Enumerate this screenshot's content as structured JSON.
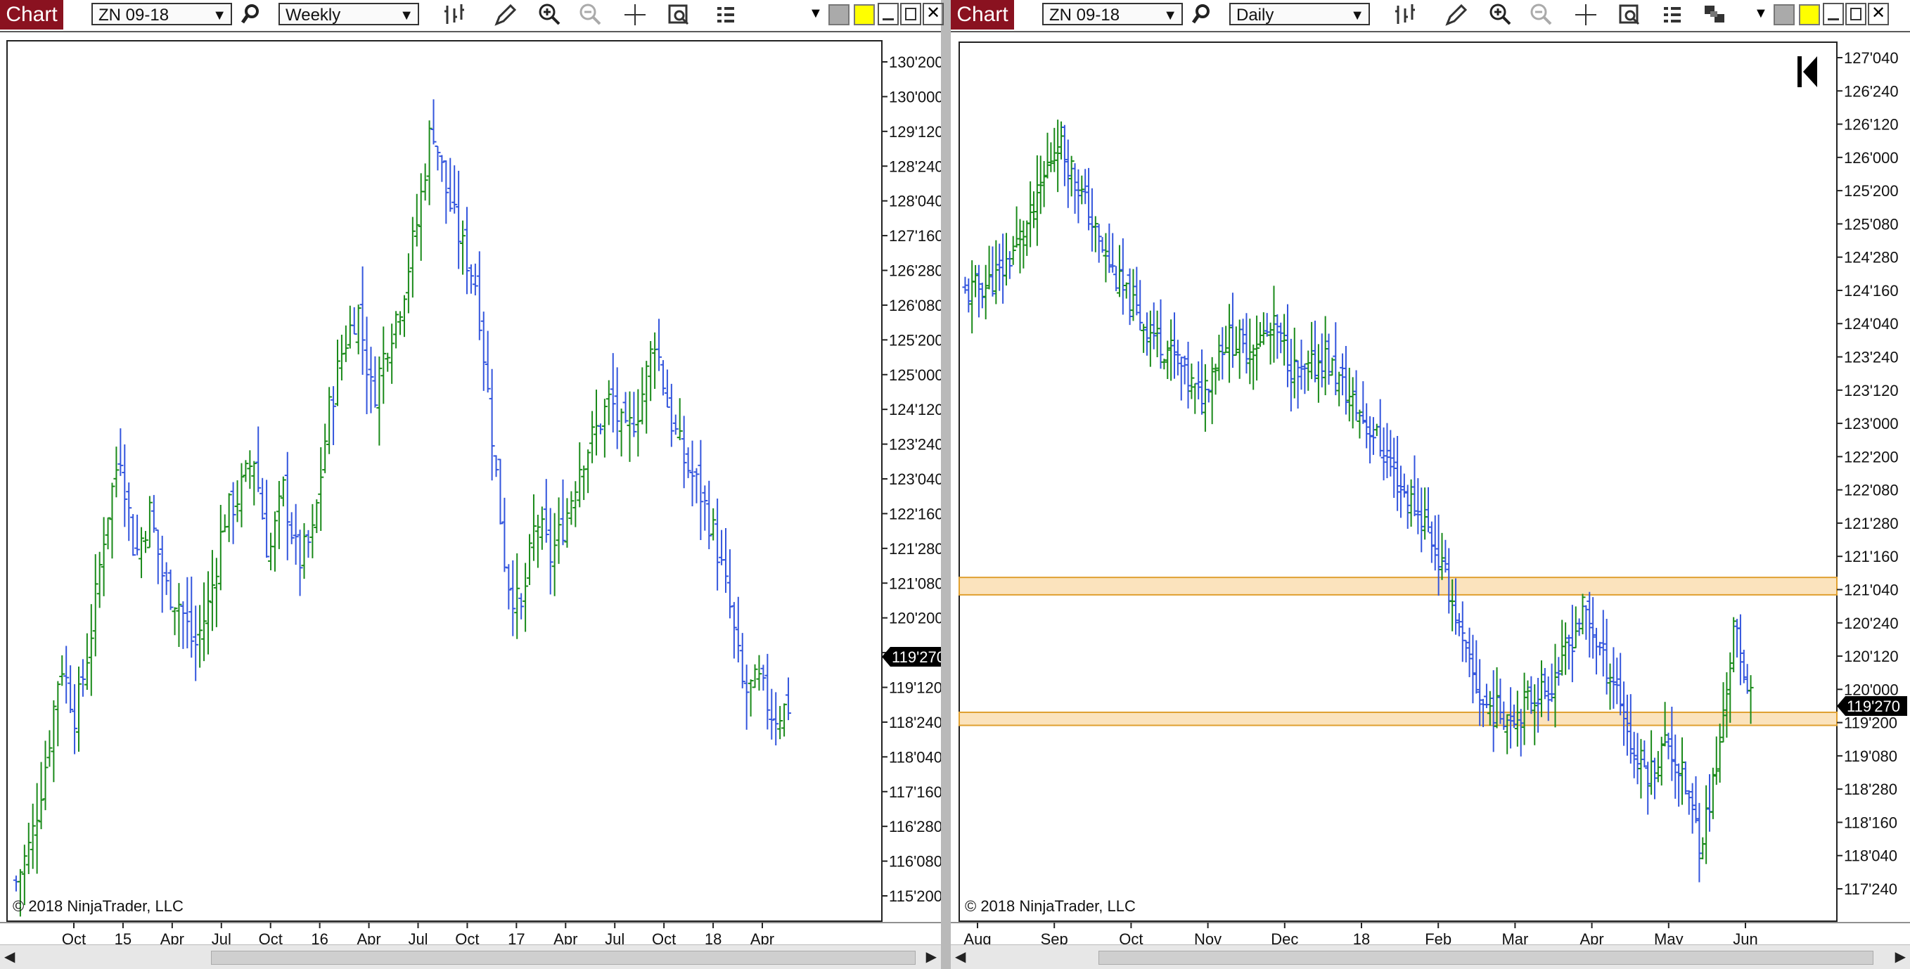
{
  "colors": {
    "up_bar": "#1a8a1a",
    "down_bar": "#3355dd",
    "zone_fill": "#fbe3bd",
    "zone_border": "#e0a030",
    "tab_bg": "#8a1220"
  },
  "left": {
    "tab_label": "Chart",
    "instrument": "ZN 09-18",
    "timeframe": "Weekly",
    "price_tag": "119'270",
    "copyright": "© 2018 NinjaTrader, LLC",
    "toolbar_icons": [
      "search-icon",
      "bar-style-icon",
      "pencil-icon",
      "zoom-in-icon",
      "zoom-out-icon",
      "crosshair-icon",
      "properties-icon",
      "indicators-icon",
      "dropdown-arrow-icon",
      "minimize-icon",
      "restore-icon",
      "close-icon"
    ],
    "y_labels": [
      "130'200",
      "130'000",
      "129'120",
      "128'240",
      "128'040",
      "127'160",
      "126'280",
      "126'080",
      "125'200",
      "125'000",
      "124'120",
      "123'240",
      "123'040",
      "122'160",
      "121'280",
      "121'080",
      "120'200",
      "120'000",
      "119'120",
      "118'240",
      "118'040",
      "117'160",
      "116'280",
      "116'080",
      "115'200"
    ],
    "x_labels": [
      "Oct",
      "15",
      "Apr",
      "Jul",
      "Oct",
      "16",
      "Apr",
      "Jul",
      "Oct",
      "17",
      "Apr",
      "Jul",
      "Oct",
      "18",
      "Apr"
    ]
  },
  "right": {
    "tab_label": "Chart",
    "instrument": "ZN 09-18",
    "timeframe": "Daily",
    "price_tag": "119'270",
    "copyright": "© 2018 NinjaTrader, LLC",
    "toolbar_icons": [
      "search-icon",
      "bar-style-icon",
      "pencil-icon",
      "zoom-in-icon",
      "zoom-out-icon",
      "crosshair-icon",
      "properties-icon",
      "indicators-icon",
      "strategies-icon",
      "dropdown-arrow-icon",
      "minimize-icon",
      "restore-icon",
      "close-icon"
    ],
    "y_labels": [
      "127'040",
      "126'240",
      "126'120",
      "126'000",
      "125'200",
      "125'080",
      "124'280",
      "124'160",
      "124'040",
      "123'240",
      "123'120",
      "123'000",
      "122'200",
      "122'080",
      "121'280",
      "121'160",
      "121'040",
      "120'240",
      "120'120",
      "120'000",
      "119'200",
      "119'080",
      "118'280",
      "118'160",
      "118'040",
      "117'240"
    ],
    "x_labels": [
      "Aug",
      "Sep",
      "Oct",
      "Nov",
      "Dec",
      "18",
      "Feb",
      "Mar",
      "Apr",
      "May",
      "Jun"
    ]
  },
  "chart_data": [
    {
      "type": "ohlc",
      "instrument": "ZN 09-18",
      "timeframe": "Weekly",
      "ylim": [
        115.4,
        130.9
      ],
      "x": [
        "Oct",
        "15",
        "Apr",
        "Jul",
        "Oct",
        "16",
        "Apr",
        "Jul",
        "Oct",
        "17",
        "Apr",
        "Jul",
        "Oct",
        "18",
        "Apr"
      ],
      "y_labels": [
        "130'200",
        "130'000",
        "129'120",
        "128'240",
        "128'040",
        "127'160",
        "126'280",
        "126'080",
        "125'200",
        "125'000",
        "124'120",
        "123'240",
        "123'040",
        "122'160",
        "121'280",
        "121'080",
        "120'200",
        "120'000",
        "119'120",
        "118'240",
        "118'040",
        "117'160",
        "116'280",
        "116'080",
        "115'200"
      ],
      "close_path": [
        [
          0,
          116.1
        ],
        [
          2,
          116.8
        ],
        [
          4,
          118.2
        ],
        [
          6,
          120.0
        ],
        [
          8,
          119.0
        ],
        [
          10,
          120.4
        ],
        [
          12,
          122.4
        ],
        [
          14,
          123.7
        ],
        [
          16,
          121.8
        ],
        [
          18,
          122.6
        ],
        [
          20,
          121.3
        ],
        [
          22,
          121.0
        ],
        [
          24,
          120.2
        ],
        [
          26,
          121.0
        ],
        [
          28,
          122.5
        ],
        [
          30,
          122.9
        ],
        [
          32,
          123.6
        ],
        [
          34,
          121.8
        ],
        [
          36,
          123.0
        ],
        [
          38,
          121.7
        ],
        [
          40,
          122.2
        ],
        [
          42,
          124.3
        ],
        [
          44,
          125.5
        ],
        [
          46,
          126.2
        ],
        [
          48,
          124.6
        ],
        [
          50,
          125.6
        ],
        [
          52,
          126.4
        ],
        [
          54,
          127.7
        ],
        [
          56,
          129.5
        ],
        [
          58,
          128.2
        ],
        [
          60,
          127.3
        ],
        [
          62,
          126.6
        ],
        [
          64,
          124.1
        ],
        [
          66,
          121.5
        ],
        [
          68,
          120.8
        ],
        [
          70,
          122.5
        ],
        [
          72,
          121.8
        ],
        [
          74,
          122.5
        ],
        [
          76,
          123.5
        ],
        [
          78,
          124.0
        ],
        [
          80,
          124.6
        ],
        [
          82,
          123.9
        ],
        [
          84,
          124.5
        ],
        [
          86,
          125.7
        ],
        [
          88,
          124.3
        ],
        [
          90,
          123.5
        ],
        [
          92,
          123.0
        ],
        [
          94,
          122.2
        ],
        [
          96,
          121.0
        ],
        [
          98,
          119.4
        ],
        [
          100,
          119.6
        ],
        [
          102,
          119.0
        ],
        [
          104,
          119.2
        ]
      ],
      "last_price": "119'270"
    },
    {
      "type": "ohlc",
      "instrument": "ZN 09-18",
      "timeframe": "Daily",
      "ylim": [
        117.2,
        127.3
      ],
      "x": [
        "Aug",
        "Sep",
        "Oct",
        "Nov",
        "Dec",
        "18",
        "Feb",
        "Mar",
        "Apr",
        "May",
        "Jun"
      ],
      "y_labels": [
        "127'040",
        "126'240",
        "126'120",
        "126'000",
        "125'200",
        "125'080",
        "124'280",
        "124'160",
        "124'040",
        "123'240",
        "123'120",
        "123'000",
        "122'200",
        "122'080",
        "121'280",
        "121'160",
        "121'040",
        "120'240",
        "120'120",
        "120'000",
        "119'200",
        "119'080",
        "118'280",
        "118'160",
        "118'040",
        "117'240"
      ],
      "close_path": [
        [
          0,
          124.4
        ],
        [
          8,
          124.6
        ],
        [
          16,
          125.3
        ],
        [
          22,
          126.2
        ],
        [
          26,
          125.8
        ],
        [
          32,
          125.0
        ],
        [
          38,
          124.4
        ],
        [
          44,
          124.0
        ],
        [
          50,
          123.7
        ],
        [
          56,
          123.2
        ],
        [
          62,
          123.9
        ],
        [
          68,
          123.8
        ],
        [
          74,
          124.0
        ],
        [
          80,
          123.4
        ],
        [
          86,
          123.7
        ],
        [
          92,
          123.2
        ],
        [
          98,
          122.8
        ],
        [
          104,
          122.2
        ],
        [
          110,
          121.8
        ],
        [
          116,
          121.0
        ],
        [
          120,
          120.2
        ],
        [
          124,
          119.7
        ],
        [
          128,
          119.6
        ],
        [
          132,
          119.6
        ],
        [
          136,
          119.8
        ],
        [
          140,
          119.9
        ],
        [
          144,
          120.3
        ],
        [
          148,
          120.8
        ],
        [
          152,
          120.3
        ],
        [
          156,
          119.9
        ],
        [
          160,
          119.1
        ],
        [
          164,
          118.9
        ],
        [
          168,
          119.3
        ],
        [
          172,
          118.8
        ],
        [
          176,
          118.1
        ],
        [
          180,
          119.0
        ],
        [
          184,
          120.6
        ],
        [
          186,
          120.1
        ],
        [
          188,
          119.9
        ]
      ],
      "zones": [
        {
          "low": 120.95,
          "high": 121.15
        },
        {
          "low": 119.45,
          "high": 119.6
        }
      ],
      "last_price": "119'270"
    }
  ]
}
